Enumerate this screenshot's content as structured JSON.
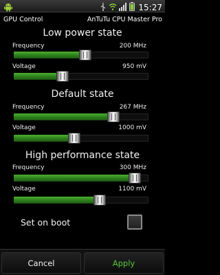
{
  "status_bar": {
    "time": "15:27",
    "notification_icon": "android-icon"
  },
  "title_bar": {
    "left": "GPU Control",
    "right": "AnTuTu CPU Master Pro"
  },
  "sections": [
    {
      "title": "Low power state",
      "frequency": {
        "label": "Frequency",
        "value": "200 MHz",
        "level": 0.53
      },
      "voltage": {
        "label": "Voltage",
        "value": "950 mV",
        "level": 0.36
      }
    },
    {
      "title": "Default state",
      "frequency": {
        "label": "Frequency",
        "value": "267 MHz",
        "level": 0.74
      },
      "voltage": {
        "label": "Voltage",
        "value": "1000 mV",
        "level": 0.45
      }
    },
    {
      "title": "High performance state",
      "frequency": {
        "label": "Frequency",
        "value": "300 MHz",
        "level": 0.9
      },
      "voltage": {
        "label": "Voltage",
        "value": "1100 mV",
        "level": 0.64
      }
    }
  ],
  "set_on_boot": {
    "label": "Set on boot",
    "checked": false
  },
  "buttons": {
    "cancel": "Cancel",
    "apply": "Apply"
  }
}
